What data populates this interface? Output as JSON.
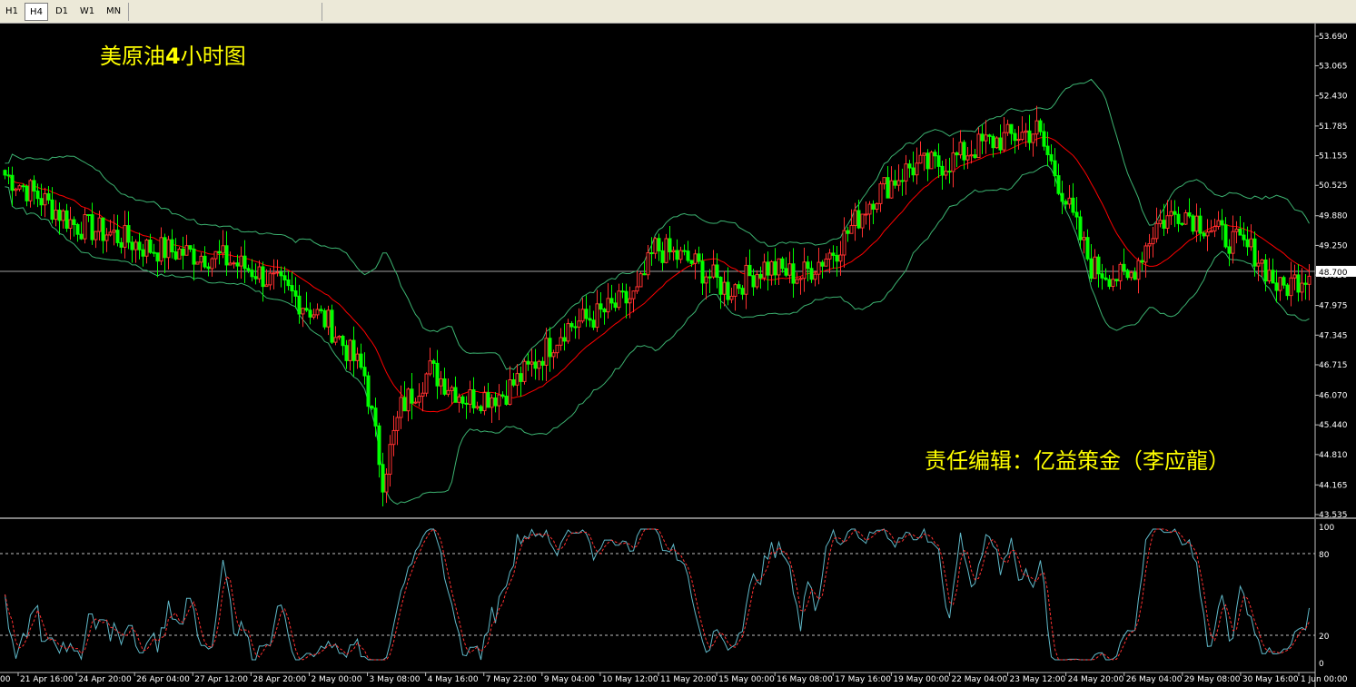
{
  "toolbar": {
    "timeframes": [
      "H1",
      "H4",
      "D1",
      "W1",
      "MN"
    ],
    "active": "H4"
  },
  "chart": {
    "title_part1": "美原油",
    "title_bold": "4",
    "title_part2": "小时图",
    "editor": "责任编辑：亿益策金（李应龍）",
    "current_price": "48.700"
  },
  "chart_data": [
    {
      "type": "candlestick",
      "price_ticks": [
        "53.690",
        "53.065",
        "52.430",
        "51.785",
        "51.155",
        "50.525",
        "49.880",
        "49.250",
        "48.620",
        "47.975",
        "47.345",
        "46.715",
        "46.070",
        "45.440",
        "44.810",
        "44.165",
        "43.535"
      ],
      "ylim": [
        43.535,
        53.69
      ],
      "time_labels": [
        "00",
        "21 Apr 16:00",
        "24 Apr 20:00",
        "26 Apr 04:00",
        "27 Apr 12:00",
        "28 Apr 20:00",
        "2 May 00:00",
        "3 May 08:00",
        "4 May 16:00",
        "7 May 22:00",
        "9 May 04:00",
        "10 May 12:00",
        "11 May 20:00",
        "15 May 00:00",
        "16 May 08:00",
        "17 May 16:00",
        "19 May 00:00",
        "22 May 04:00",
        "23 May 12:00",
        "24 May 20:00",
        "26 May 04:00",
        "29 May 08:00",
        "30 May 16:00",
        "1 Jun 00:00"
      ],
      "close_path": [
        {
          "t": 0,
          "v": 50.8
        },
        {
          "t": 10,
          "v": 50.3
        },
        {
          "t": 20,
          "v": 49.7
        },
        {
          "t": 30,
          "v": 49.5
        },
        {
          "t": 40,
          "v": 49.2
        },
        {
          "t": 50,
          "v": 49.1
        },
        {
          "t": 60,
          "v": 49.0
        },
        {
          "t": 70,
          "v": 48.7
        },
        {
          "t": 80,
          "v": 48.2
        },
        {
          "t": 90,
          "v": 47.6
        },
        {
          "t": 100,
          "v": 46.5
        },
        {
          "t": 105,
          "v": 44.3
        },
        {
          "t": 110,
          "v": 45.8
        },
        {
          "t": 118,
          "v": 46.6
        },
        {
          "t": 128,
          "v": 46.0
        },
        {
          "t": 138,
          "v": 46.1
        },
        {
          "t": 145,
          "v": 46.6
        },
        {
          "t": 155,
          "v": 47.5
        },
        {
          "t": 165,
          "v": 47.8
        },
        {
          "t": 175,
          "v": 48.2
        },
        {
          "t": 180,
          "v": 49.2
        },
        {
          "t": 190,
          "v": 48.9
        },
        {
          "t": 200,
          "v": 48.3
        },
        {
          "t": 210,
          "v": 48.8
        },
        {
          "t": 220,
          "v": 48.6
        },
        {
          "t": 230,
          "v": 49.2
        },
        {
          "t": 240,
          "v": 50.3
        },
        {
          "t": 250,
          "v": 50.9
        },
        {
          "t": 260,
          "v": 51.0
        },
        {
          "t": 270,
          "v": 51.4
        },
        {
          "t": 280,
          "v": 51.6
        },
        {
          "t": 285,
          "v": 51.7
        },
        {
          "t": 290,
          "v": 50.8
        },
        {
          "t": 300,
          "v": 48.8
        },
        {
          "t": 310,
          "v": 48.5
        },
        {
          "t": 318,
          "v": 49.7
        },
        {
          "t": 325,
          "v": 50.0
        },
        {
          "t": 335,
          "v": 49.5
        },
        {
          "t": 345,
          "v": 49.1
        },
        {
          "t": 352,
          "v": 48.3
        },
        {
          "t": 360,
          "v": 48.7
        }
      ],
      "indicators": [
        "Bollinger Bands",
        "Moving Average"
      ]
    },
    {
      "type": "line",
      "name": "Stochastic",
      "yticks": [
        "100",
        "80",
        "20",
        "0"
      ],
      "levels": [
        80,
        20
      ],
      "ylim": [
        0,
        100
      ]
    }
  ]
}
